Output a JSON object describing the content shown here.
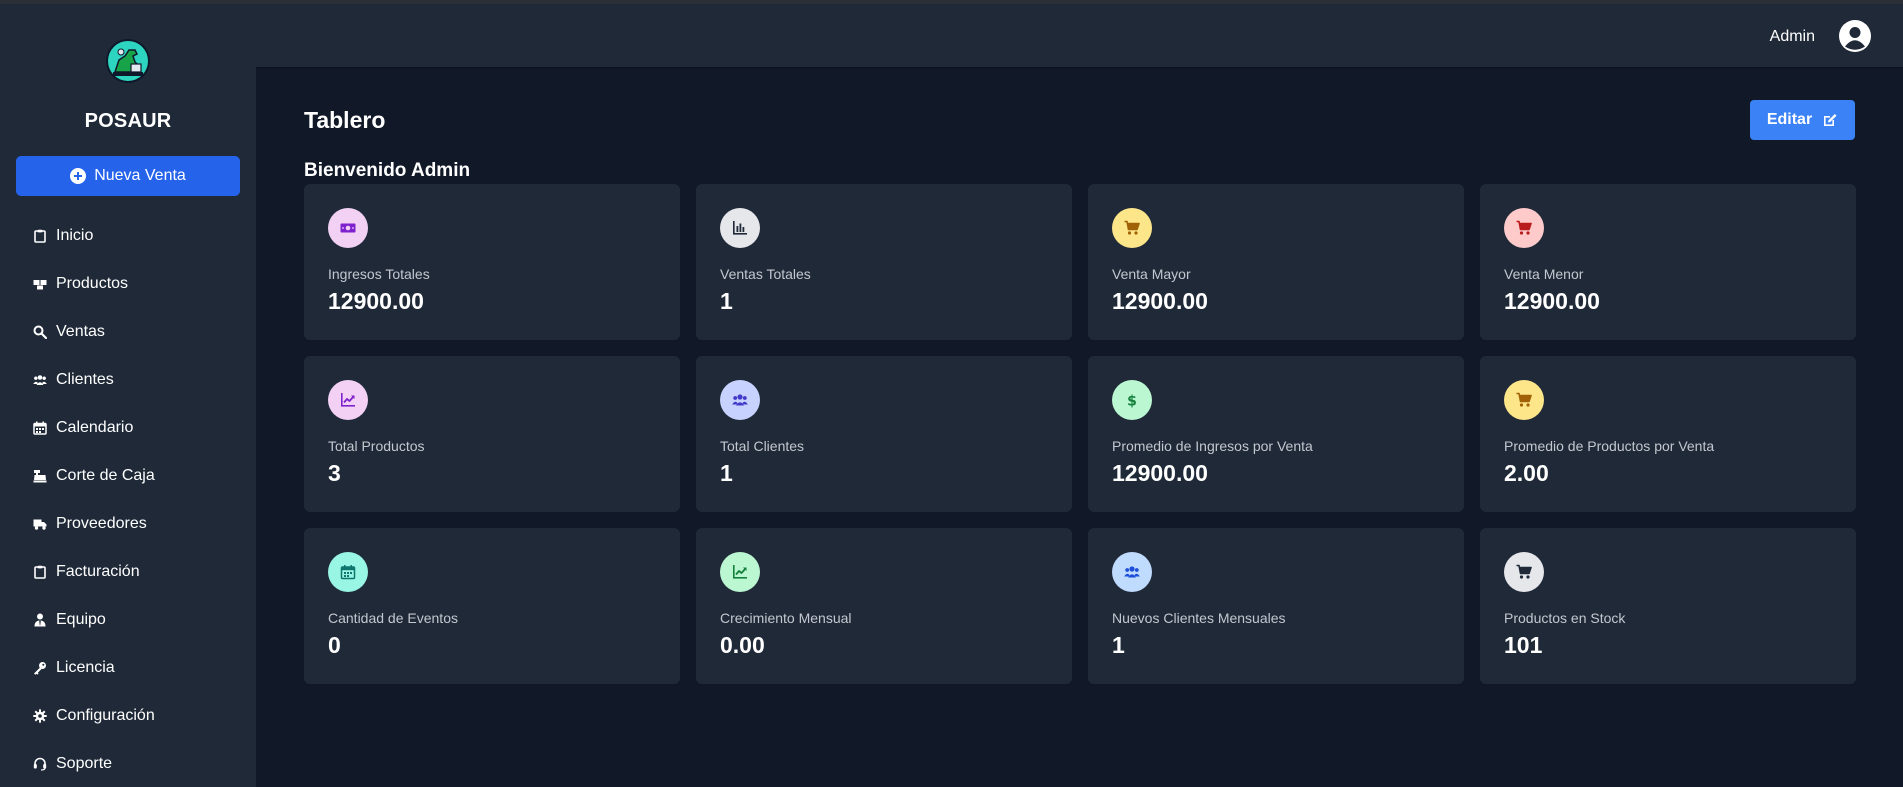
{
  "sidebar": {
    "brand": "POSAUR",
    "new_sale_label": "Nueva Venta",
    "items": [
      {
        "label": "Inicio",
        "icon": "clipboard-icon"
      },
      {
        "label": "Productos",
        "icon": "boxes-icon"
      },
      {
        "label": "Ventas",
        "icon": "search-icon"
      },
      {
        "label": "Clientes",
        "icon": "users-icon"
      },
      {
        "label": "Calendario",
        "icon": "calendar-icon"
      },
      {
        "label": "Corte de Caja",
        "icon": "cash-register-icon"
      },
      {
        "label": "Proveedores",
        "icon": "truck-icon"
      },
      {
        "label": "Facturación",
        "icon": "clipboard-icon"
      },
      {
        "label": "Equipo",
        "icon": "user-tie-icon"
      },
      {
        "label": "Licencia",
        "icon": "key-icon"
      },
      {
        "label": "Configuración",
        "icon": "gear-icon"
      },
      {
        "label": "Soporte",
        "icon": "headset-icon"
      }
    ]
  },
  "header": {
    "user_name": "Admin"
  },
  "main": {
    "title": "Tablero",
    "edit_label": "Editar",
    "welcome": "Bienvenido Admin",
    "cards": [
      {
        "label": "Ingresos Totales",
        "value": "12900.00",
        "icon": "money-bill-icon",
        "bg": "#f3d1f4",
        "fg": "#7e22ce"
      },
      {
        "label": "Ventas Totales",
        "value": "1",
        "icon": "bar-chart-icon",
        "bg": "#e5e7eb",
        "fg": "#1f2937"
      },
      {
        "label": "Venta Mayor",
        "value": "12900.00",
        "icon": "cart-icon",
        "bg": "#fde68a",
        "fg": "#a16207"
      },
      {
        "label": "Venta Menor",
        "value": "12900.00",
        "icon": "cart-icon",
        "bg": "#fecaca",
        "fg": "#b91c1c"
      },
      {
        "label": "Total Productos",
        "value": "3",
        "icon": "chart-line-icon",
        "bg": "#f3d1f4",
        "fg": "#7e22ce"
      },
      {
        "label": "Total Clientes",
        "value": "1",
        "icon": "users-icon",
        "bg": "#c7d2fe",
        "fg": "#4338ca"
      },
      {
        "label": "Promedio de Ingresos por Venta",
        "value": "12900.00",
        "icon": "dollar-icon",
        "bg": "#bbf7d0",
        "fg": "#15803d"
      },
      {
        "label": "Promedio de Productos por Venta",
        "value": "2.00",
        "icon": "cart-icon",
        "bg": "#fde68a",
        "fg": "#a16207"
      },
      {
        "label": "Cantidad de Eventos",
        "value": "0",
        "icon": "calendar-icon",
        "bg": "#99f6e4",
        "fg": "#0f766e"
      },
      {
        "label": "Crecimiento Mensual",
        "value": "0.00",
        "icon": "chart-line-icon",
        "bg": "#bbf7d0",
        "fg": "#15803d"
      },
      {
        "label": "Nuevos Clientes Mensuales",
        "value": "1",
        "icon": "users-icon",
        "bg": "#bfdbfe",
        "fg": "#1d4ed8"
      },
      {
        "label": "Productos en Stock",
        "value": "101",
        "icon": "cart-icon",
        "bg": "#e5e7eb",
        "fg": "#1f2937"
      }
    ]
  }
}
